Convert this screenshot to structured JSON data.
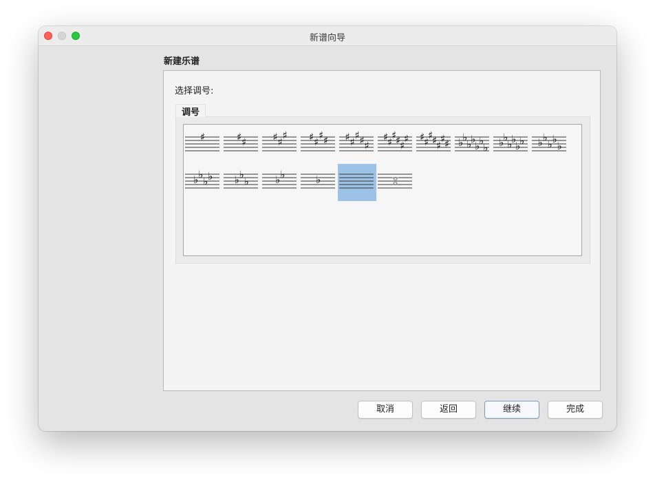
{
  "window": {
    "title": "新谱向导"
  },
  "page": {
    "header": "新建乐谱",
    "prompt": "选择调号:"
  },
  "group": {
    "label": "调号"
  },
  "palette": {
    "selected_key": "none",
    "keys": [
      {
        "name": "G major",
        "accidental": "sharp",
        "count": 1
      },
      {
        "name": "D major",
        "accidental": "sharp",
        "count": 2
      },
      {
        "name": "A major",
        "accidental": "sharp",
        "count": 3
      },
      {
        "name": "E major",
        "accidental": "sharp",
        "count": 4
      },
      {
        "name": "B major",
        "accidental": "sharp",
        "count": 5
      },
      {
        "name": "F# major",
        "accidental": "sharp",
        "count": 6
      },
      {
        "name": "C# major",
        "accidental": "sharp",
        "count": 7
      },
      {
        "name": "Cb major",
        "accidental": "flat",
        "count": 7
      },
      {
        "name": "Gb major",
        "accidental": "flat",
        "count": 6
      },
      {
        "name": "Db major",
        "accidental": "flat",
        "count": 5
      },
      {
        "name": "Ab major",
        "accidental": "flat",
        "count": 4
      },
      {
        "name": "Eb major",
        "accidental": "flat",
        "count": 3
      },
      {
        "name": "Bb major",
        "accidental": "flat",
        "count": 2
      },
      {
        "name": "F major",
        "accidental": "flat",
        "count": 1
      },
      {
        "name": "C major",
        "accidental": "none",
        "count": 0
      },
      {
        "name": "Atonal",
        "accidental": "open",
        "count": 0
      }
    ]
  },
  "buttons": {
    "cancel": "取消",
    "back": "返回",
    "next": "继续",
    "finish": "完成"
  },
  "colors": {
    "selection": "#9cc3e5",
    "close": "#fe5f57",
    "maximize": "#28c840"
  }
}
